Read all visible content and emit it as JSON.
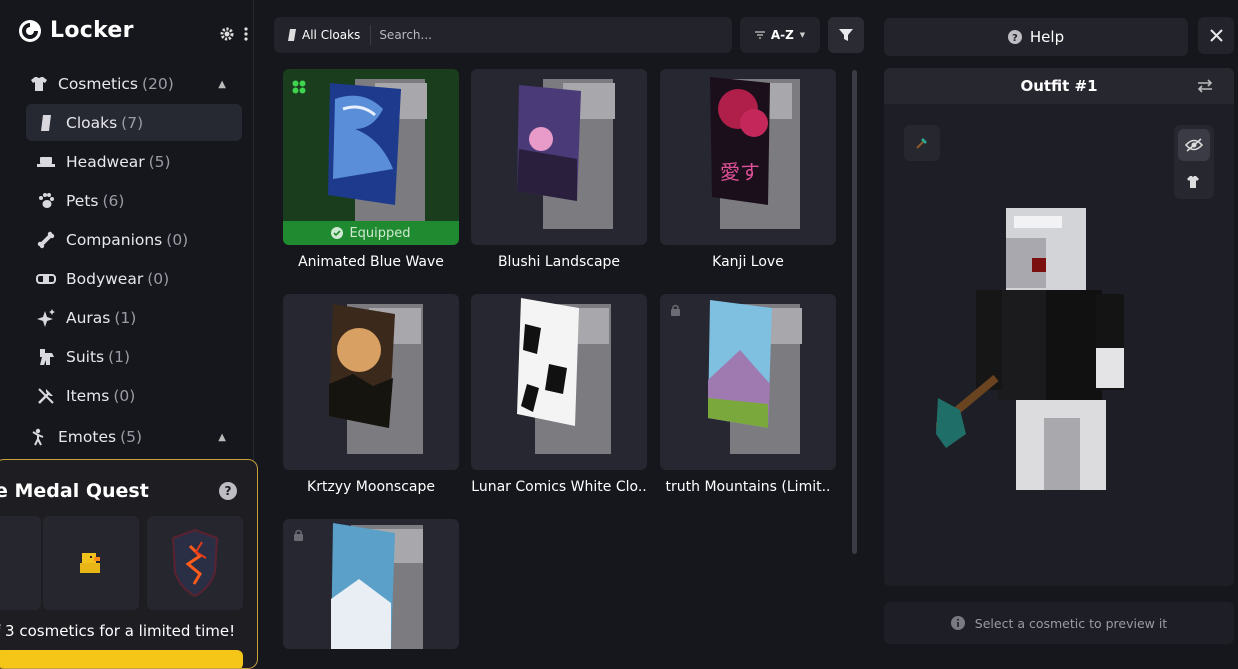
{
  "app": {
    "title": "Locker"
  },
  "sidebar": {
    "cosmetics": {
      "label": "Cosmetics",
      "count": "(20)"
    },
    "items": [
      {
        "label": "Cloaks",
        "count": "(7)",
        "icon": "cloak-icon",
        "active": true
      },
      {
        "label": "Headwear",
        "count": "(5)",
        "icon": "headwear-icon"
      },
      {
        "label": "Pets",
        "count": "(6)",
        "icon": "paw-icon"
      },
      {
        "label": "Companions",
        "count": "(0)",
        "icon": "bone-icon"
      },
      {
        "label": "Bodywear",
        "count": "(0)",
        "icon": "bodywear-icon"
      },
      {
        "label": "Auras",
        "count": "(1)",
        "icon": "sparkle-icon"
      },
      {
        "label": "Suits",
        "count": "(1)",
        "icon": "suit-icon"
      },
      {
        "label": "Items",
        "count": "(0)",
        "icon": "items-icon"
      }
    ],
    "emotes": {
      "label": "Emotes",
      "count": "(5)"
    }
  },
  "quest": {
    "title": "e Medal Quest",
    "description": "f 3 cosmetics for a limited time!"
  },
  "toolbar": {
    "filter_chip": "All Cloaks",
    "search_placeholder": "Search...",
    "sort_label": "A-Z"
  },
  "grid": {
    "cards": [
      {
        "name": "Animated Blue Wave",
        "equipped": true
      },
      {
        "name": "Blushi Landscape"
      },
      {
        "name": "Kanji Love"
      },
      {
        "name": "Krtzyy Moonscape"
      },
      {
        "name": "Lunar Comics White Clo.."
      },
      {
        "name": "truth Mountains (Limit..",
        "locked": true
      },
      {
        "name": "",
        "locked": true
      }
    ],
    "equipped_label": "Equipped"
  },
  "right": {
    "help_label": "Help",
    "outfit_title": "Outfit #1",
    "status_text": "Select a cosmetic to preview it"
  }
}
